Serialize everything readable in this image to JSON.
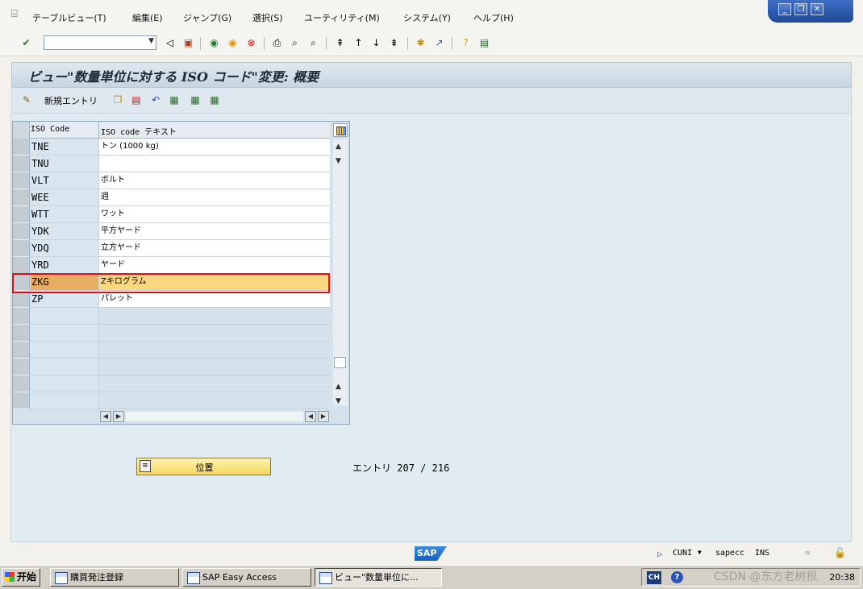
{
  "menu": {
    "items": [
      "テーブルビュー(T)",
      "編集(E)",
      "ジャンプ(G)",
      "選択(S)",
      "ユーティリティ(M)",
      "システム(Y)",
      "ヘルプ(H)"
    ]
  },
  "toolbar": {
    "command_field_value": ""
  },
  "title": "ビュー\"数量単位に対する ISO コード\"変更: 概要",
  "app_toolbar": {
    "new_entries_label": "新規エントリ"
  },
  "table": {
    "columns": [
      "ISO Code",
      "ISO code テキスト"
    ],
    "rows": [
      {
        "code": "TNE",
        "text": "トン (1000 kg)"
      },
      {
        "code": "TNU",
        "text": ""
      },
      {
        "code": "VLT",
        "text": "ボルト"
      },
      {
        "code": "WEE",
        "text": "週"
      },
      {
        "code": "WTT",
        "text": "ワット"
      },
      {
        "code": "YDK",
        "text": "平方ヤード"
      },
      {
        "code": "YDQ",
        "text": "立方ヤード"
      },
      {
        "code": "YRD",
        "text": "ヤード"
      },
      {
        "code": "ZKG",
        "text": "Zキログラム"
      },
      {
        "code": "ZP",
        "text": "パレット"
      }
    ],
    "selected_row_code": "ZKG"
  },
  "position_button_label": "位置",
  "entries": {
    "label": "エントリ",
    "current": "207",
    "separator": "/",
    "total": "216"
  },
  "status": {
    "sap_logo": "SAP",
    "transaction": "CUNI",
    "system": "sapecc",
    "mode": "INS"
  },
  "taskbar": {
    "start_label": "开始",
    "tasks": [
      "購買発注登録",
      "SAP Easy Access",
      "ビュー\"数量単位に..."
    ],
    "tray_lang": "CH",
    "clock": "20:38"
  },
  "watermark": "CSDN @东方老树根",
  "colors": {
    "selected_row": "#fbd77f",
    "highlight_border": "#e0101a",
    "title_bg": "#c7d6e2"
  }
}
